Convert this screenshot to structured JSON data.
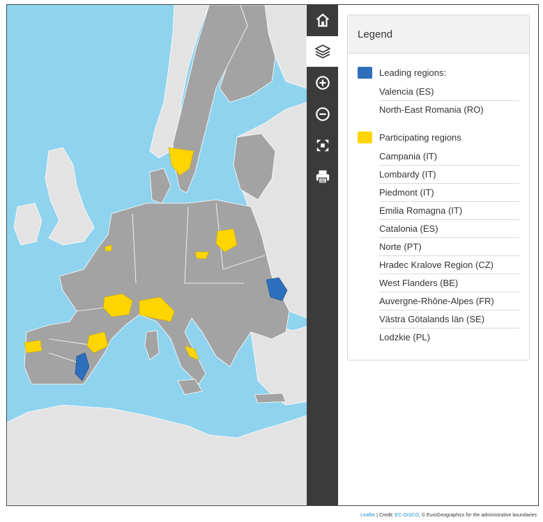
{
  "toolbar": {
    "buttons": [
      {
        "name": "home",
        "icon": "home-icon"
      },
      {
        "name": "layers",
        "icon": "layers-icon"
      },
      {
        "name": "zoom-in",
        "icon": "zoom-in-icon"
      },
      {
        "name": "zoom-out",
        "icon": "zoom-out-icon"
      },
      {
        "name": "fullscreen",
        "icon": "fullscreen-icon"
      },
      {
        "name": "print",
        "icon": "print-icon"
      }
    ]
  },
  "legend": {
    "title": "Legend",
    "groups": [
      {
        "label": "Leading regions:",
        "color": "#2e6fbd",
        "items": [
          "Valencia (ES)",
          "North-East Romania (RO)"
        ]
      },
      {
        "label": "Participating regions",
        "color": "#ffd500",
        "items": [
          "Campania (IT)",
          "Lombardy (IT)",
          "Piedmont (IT)",
          "Emilia Romagna (IT)",
          "Catalonia (ES)",
          "Norte (PT)",
          "Hradec Kralove Region (CZ)",
          "West Flanders (BE)",
          "Auvergne-Rhône-Alpes (FR)",
          "Västra Götalands län (SE)",
          "Lodzkie (PL)"
        ]
      }
    ]
  },
  "map": {
    "colors": {
      "sea": "#8fd3ee",
      "member_land": "#a3a3a3",
      "other_land": "#e3e3e3",
      "leading": "#2e6fbd",
      "participating": "#ffd500"
    }
  },
  "attribution": {
    "leaflet": "Leaflet",
    "separator": " | Credit: ",
    "ec_gisco": "EC-GISCO",
    "rest": ", © EuroGeographics for the administrative boundaries"
  }
}
